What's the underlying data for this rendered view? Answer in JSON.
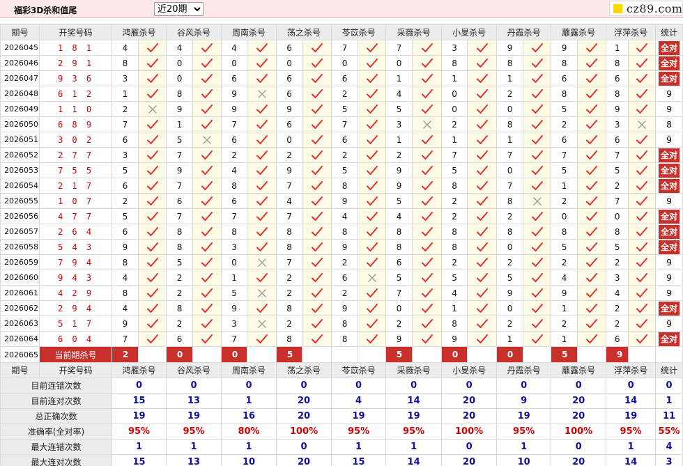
{
  "topbar": {
    "title": "福彩3D杀和值尾",
    "period_select": "近20期",
    "period_options": [
      "近20期"
    ],
    "brand": "cz89.com"
  },
  "headers": [
    "期号",
    "开奖号码",
    "鸿雁杀号",
    "谷风杀号",
    "周南杀号",
    "荡之杀号",
    "苓苡杀号",
    "采薇杀号",
    "小旻杀号",
    "丹霞杀号",
    "蘼露杀号",
    "浮萍杀号",
    "统计"
  ],
  "rows": [
    {
      "issue": "2026045",
      "draw": "181",
      "kills": [
        4,
        4,
        4,
        6,
        7,
        7,
        3,
        9,
        9,
        1
      ],
      "ok": [
        1,
        1,
        1,
        1,
        1,
        1,
        1,
        1,
        1,
        1
      ],
      "stat": "全对"
    },
    {
      "issue": "2026046",
      "draw": "291",
      "kills": [
        8,
        0,
        0,
        0,
        0,
        0,
        8,
        8,
        8,
        8
      ],
      "ok": [
        1,
        1,
        1,
        1,
        1,
        1,
        1,
        1,
        1,
        1
      ],
      "stat": "全对"
    },
    {
      "issue": "2026047",
      "draw": "936",
      "kills": [
        3,
        0,
        6,
        6,
        6,
        1,
        1,
        1,
        6,
        6
      ],
      "ok": [
        1,
        1,
        1,
        1,
        1,
        1,
        1,
        1,
        1,
        1
      ],
      "stat": "全对"
    },
    {
      "issue": "2026048",
      "draw": "612",
      "kills": [
        1,
        8,
        9,
        6,
        2,
        4,
        0,
        2,
        8,
        8
      ],
      "ok": [
        1,
        1,
        0,
        1,
        1,
        1,
        1,
        1,
        1,
        1
      ],
      "stat": "9"
    },
    {
      "issue": "2026049",
      "draw": "110",
      "kills": [
        2,
        9,
        9,
        9,
        5,
        5,
        0,
        0,
        5,
        9
      ],
      "ok": [
        0,
        1,
        1,
        1,
        1,
        1,
        1,
        1,
        1,
        1
      ],
      "stat": "9"
    },
    {
      "issue": "2026050",
      "draw": "689",
      "kills": [
        7,
        1,
        7,
        6,
        7,
        3,
        2,
        8,
        2,
        3
      ],
      "ok": [
        1,
        1,
        1,
        1,
        1,
        0,
        1,
        1,
        1,
        0
      ],
      "stat": "8"
    },
    {
      "issue": "2026051",
      "draw": "302",
      "kills": [
        6,
        5,
        6,
        0,
        6,
        1,
        1,
        1,
        6,
        6
      ],
      "ok": [
        1,
        0,
        1,
        1,
        1,
        1,
        1,
        1,
        1,
        1
      ],
      "stat": "9"
    },
    {
      "issue": "2026052",
      "draw": "277",
      "kills": [
        3,
        7,
        2,
        2,
        2,
        2,
        7,
        7,
        7,
        7
      ],
      "ok": [
        1,
        1,
        1,
        1,
        1,
        1,
        1,
        1,
        1,
        1
      ],
      "stat": "全对"
    },
    {
      "issue": "2026053",
      "draw": "755",
      "kills": [
        5,
        9,
        4,
        9,
        5,
        9,
        5,
        0,
        5,
        5
      ],
      "ok": [
        1,
        1,
        1,
        1,
        1,
        1,
        1,
        1,
        1,
        1
      ],
      "stat": "全对"
    },
    {
      "issue": "2026054",
      "draw": "217",
      "kills": [
        6,
        7,
        8,
        7,
        8,
        9,
        8,
        7,
        1,
        2
      ],
      "ok": [
        1,
        1,
        1,
        1,
        1,
        1,
        1,
        1,
        1,
        1
      ],
      "stat": "全对"
    },
    {
      "issue": "2026055",
      "draw": "107",
      "kills": [
        2,
        6,
        6,
        4,
        9,
        5,
        2,
        8,
        2,
        7
      ],
      "ok": [
        1,
        1,
        1,
        1,
        1,
        1,
        1,
        0,
        1,
        1
      ],
      "stat": "9"
    },
    {
      "issue": "2026056",
      "draw": "477",
      "kills": [
        5,
        7,
        7,
        7,
        4,
        4,
        2,
        2,
        0,
        0
      ],
      "ok": [
        1,
        1,
        1,
        1,
        1,
        1,
        1,
        1,
        1,
        1
      ],
      "stat": "全对"
    },
    {
      "issue": "2026057",
      "draw": "264",
      "kills": [
        6,
        8,
        8,
        8,
        8,
        8,
        8,
        8,
        8,
        8
      ],
      "ok": [
        1,
        1,
        1,
        1,
        1,
        1,
        1,
        1,
        1,
        1
      ],
      "stat": "全对"
    },
    {
      "issue": "2026058",
      "draw": "543",
      "kills": [
        9,
        8,
        3,
        8,
        9,
        8,
        8,
        0,
        5,
        5
      ],
      "ok": [
        1,
        1,
        1,
        1,
        1,
        1,
        1,
        1,
        1,
        1
      ],
      "stat": "全对"
    },
    {
      "issue": "2026059",
      "draw": "794",
      "kills": [
        8,
        5,
        0,
        7,
        2,
        6,
        2,
        2,
        2,
        2
      ],
      "ok": [
        1,
        1,
        0,
        1,
        1,
        1,
        1,
        1,
        1,
        1
      ],
      "stat": "9"
    },
    {
      "issue": "2026060",
      "draw": "943",
      "kills": [
        4,
        2,
        1,
        2,
        6,
        5,
        5,
        5,
        4,
        3
      ],
      "ok": [
        1,
        1,
        1,
        1,
        0,
        1,
        1,
        1,
        1,
        1
      ],
      "stat": "9"
    },
    {
      "issue": "2026061",
      "draw": "429",
      "kills": [
        8,
        2,
        5,
        2,
        2,
        7,
        4,
        9,
        9,
        4
      ],
      "ok": [
        1,
        1,
        0,
        1,
        1,
        1,
        1,
        1,
        1,
        1
      ],
      "stat": "9"
    },
    {
      "issue": "2026062",
      "draw": "294",
      "kills": [
        4,
        8,
        9,
        8,
        9,
        0,
        1,
        0,
        1,
        2
      ],
      "ok": [
        1,
        1,
        1,
        1,
        1,
        1,
        1,
        1,
        1,
        1
      ],
      "stat": "全对"
    },
    {
      "issue": "2026063",
      "draw": "517",
      "kills": [
        9,
        2,
        3,
        2,
        8,
        2,
        8,
        2,
        2,
        2
      ],
      "ok": [
        1,
        1,
        0,
        1,
        1,
        1,
        1,
        1,
        1,
        1
      ],
      "stat": "9"
    },
    {
      "issue": "2026064",
      "draw": "604",
      "kills": [
        7,
        6,
        7,
        8,
        8,
        9,
        9,
        1,
        1,
        6
      ],
      "ok": [
        1,
        1,
        1,
        1,
        1,
        1,
        1,
        1,
        1,
        1
      ],
      "stat": "全对"
    }
  ],
  "current": {
    "issue": "2026065",
    "label": "当前期杀号",
    "kills": [
      "2",
      "0",
      "0",
      "5",
      "",
      "5",
      "0",
      "0",
      "5",
      "9"
    ]
  },
  "stats": [
    {
      "label": "目前连错次数",
      "values": [
        "0",
        "0",
        "0",
        "0",
        "0",
        "0",
        "0",
        "0",
        "0",
        "0",
        "0"
      ],
      "red": false
    },
    {
      "label": "目前连对次数",
      "values": [
        "15",
        "13",
        "1",
        "20",
        "4",
        "14",
        "20",
        "9",
        "20",
        "14",
        "1"
      ],
      "red": false
    },
    {
      "label": "总正确次数",
      "values": [
        "19",
        "19",
        "16",
        "20",
        "19",
        "19",
        "20",
        "19",
        "20",
        "19",
        "11"
      ],
      "red": false
    },
    {
      "label": "准确率(全对率)",
      "values": [
        "95%",
        "95%",
        "80%",
        "100%",
        "95%",
        "95%",
        "100%",
        "95%",
        "100%",
        "95%",
        "55%"
      ],
      "red": true
    },
    {
      "label": "最大连错次数",
      "values": [
        "1",
        "1",
        "1",
        "0",
        "1",
        "1",
        "0",
        "1",
        "0",
        "1",
        "4"
      ],
      "red": false
    },
    {
      "label": "最大连对次数",
      "values": [
        "15",
        "13",
        "10",
        "20",
        "15",
        "14",
        "20",
        "10",
        "20",
        "14",
        "3"
      ],
      "red": false
    }
  ],
  "colors": {
    "check": "#e03030",
    "cross": "#9a9a9a",
    "accent": "#c9302c",
    "stat_blue": "#1010a0",
    "header_bg": "#ececec",
    "mark_bg": "#fdfbe6"
  }
}
